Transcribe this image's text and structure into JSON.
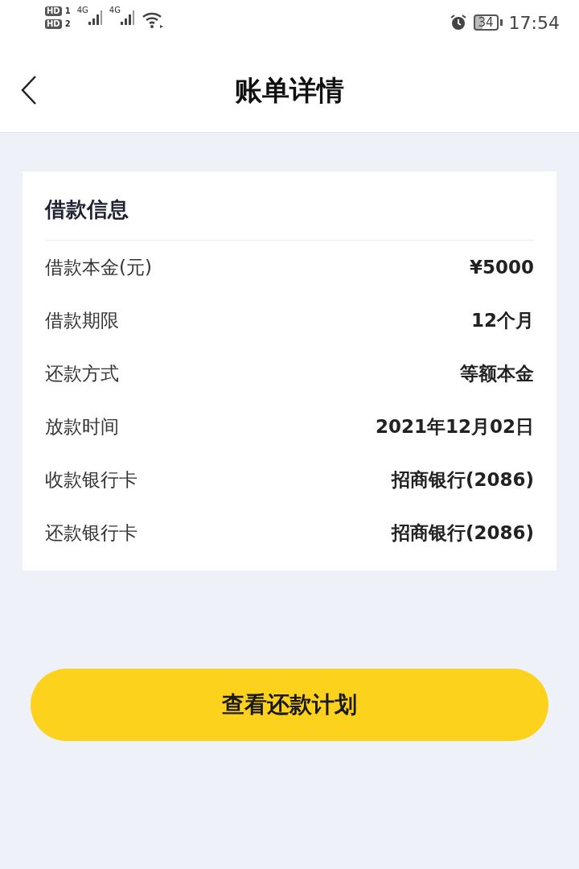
{
  "status_bar": {
    "sims": [
      {
        "badge": "HD",
        "slot": "1",
        "network": "4G"
      },
      {
        "badge": "HD",
        "slot": "2",
        "network": "4G"
      }
    ],
    "battery": "34",
    "time": "17:54"
  },
  "header": {
    "title": "账单详情"
  },
  "card": {
    "title": "借款信息",
    "rows": [
      {
        "label": "借款本金(元)",
        "value": "¥5000"
      },
      {
        "label": "借款期限",
        "value": "12个月"
      },
      {
        "label": "还款方式",
        "value": "等额本金"
      },
      {
        "label": "放款时间",
        "value": "2021年12月02日"
      },
      {
        "label": "收款银行卡",
        "value": "招商银行(2086)"
      },
      {
        "label": "还款银行卡",
        "value": "招商银行(2086)"
      }
    ]
  },
  "button": {
    "label": "查看还款计划"
  }
}
